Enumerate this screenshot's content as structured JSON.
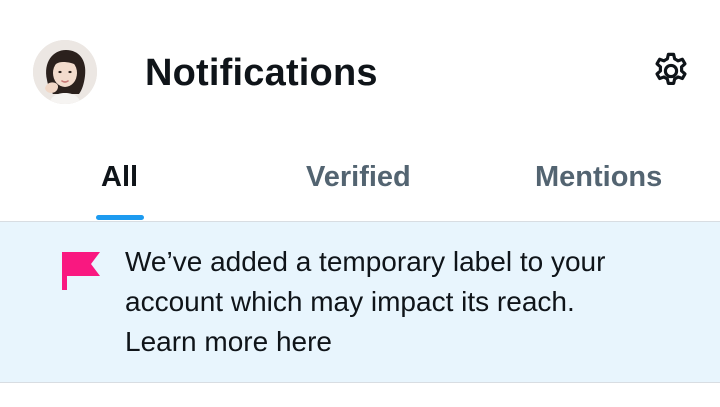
{
  "header": {
    "title": "Notifications",
    "avatar_icon": "user-avatar",
    "settings_icon": "gear-icon"
  },
  "tabs": [
    {
      "label": "All",
      "selected": true
    },
    {
      "label": "Verified",
      "selected": false
    },
    {
      "label": "Mentions",
      "selected": false
    }
  ],
  "notice": {
    "icon": "flag-icon",
    "icon_color": "#f91880",
    "message": "We’ve added a temporary label to your account which may impact its reach.",
    "link_text": "Learn more here"
  },
  "colors": {
    "accent": "#1d9bf0",
    "banner_background": "#e8f5fd",
    "text_primary": "#0f1419",
    "text_secondary": "#536471"
  }
}
